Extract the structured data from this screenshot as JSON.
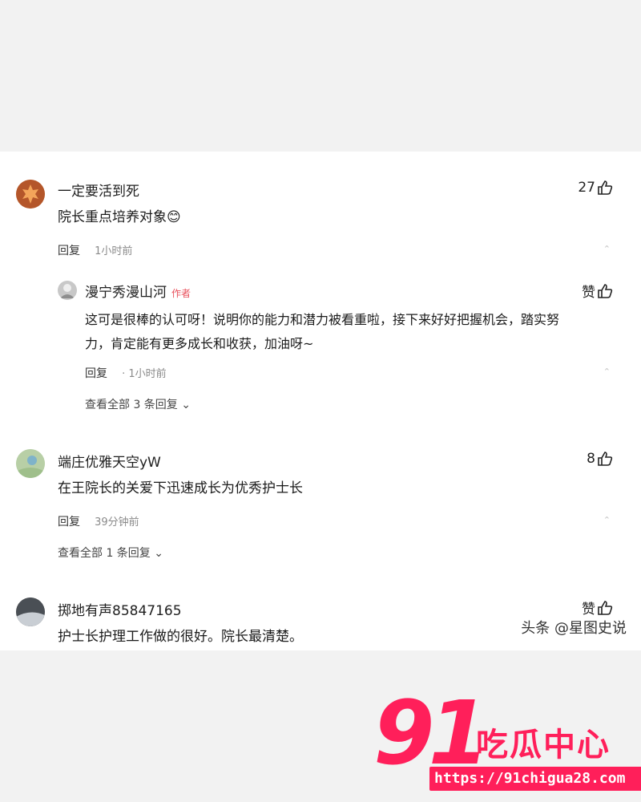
{
  "comments": [
    {
      "username": "一定要活到死",
      "text": "院长重点培养对象😊",
      "reply_label": "回复",
      "time": "1小时前",
      "likes": "27",
      "reply": {
        "username": "漫宁秀漫山河",
        "author_tag": "作者",
        "text_line1": "这可是很棒的认可呀！说明你的能力和潜力被看重啦，接下来好好把握机会，踏实努",
        "text_line2": "力，肯定能有更多成长和收获，加油呀~",
        "reply_label": "回复",
        "time": "· 1小时前",
        "likes": "赞"
      },
      "view_more": "查看全部 3 条回复"
    },
    {
      "username": "端庄优雅天空yW",
      "text": "在王院长的关爱下迅速成长为优秀护士长",
      "reply_label": "回复",
      "time": "39分钟前",
      "likes": "8",
      "view_more": "查看全部 1 条回复"
    },
    {
      "username": "掷地有声85847165",
      "text": "护士长护理工作做的很好。院长最清楚。",
      "likes": "赞"
    }
  ],
  "watermark": "头条 @星图史说",
  "logo": {
    "number": "91",
    "name": "吃瓜中心",
    "url": "https://91chigua28.com"
  },
  "colors": {
    "brand": "#ff1f5a",
    "author_tag": "#e8505b"
  }
}
